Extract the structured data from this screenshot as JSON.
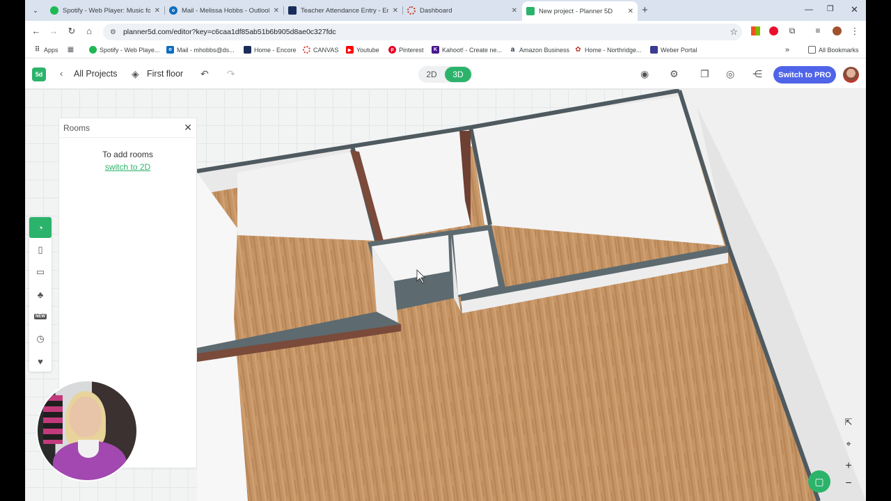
{
  "browser": {
    "tabs": [
      {
        "title": "Spotify - Web Player: Music for",
        "color": "#1db954",
        "active": false
      },
      {
        "title": "Mail - Melissa Hobbs - Outlook",
        "color": "#0f6cbd",
        "active": false
      },
      {
        "title": "Teacher Attendance Entry - Enc",
        "color": "#1a2d5a",
        "active": false
      },
      {
        "title": "Dashboard",
        "color": "#c0392b",
        "active": false
      },
      {
        "title": "New project - Planner 5D",
        "color": "#2cb36b",
        "active": true
      }
    ],
    "url": "planner5d.com/editor?key=c6caa1df85ab51b6b905d8ae0c327fdc",
    "bookmarks": [
      {
        "label": "Apps",
        "color": "#5f6368"
      },
      {
        "label": "Spotify - Web Playe...",
        "color": "#1db954"
      },
      {
        "label": "Mail - mhobbs@ds...",
        "color": "#0f6cbd"
      },
      {
        "label": "Home - Encore",
        "color": "#1a2d5a"
      },
      {
        "label": "CANVAS",
        "color": "#e03c31"
      },
      {
        "label": "Youtube",
        "color": "#ff0000"
      },
      {
        "label": "Pinterest",
        "color": "#e60023"
      },
      {
        "label": "Kahoot! - Create ne...",
        "color": "#46178f"
      },
      {
        "label": "Amazon Business",
        "color": "#232f3e"
      },
      {
        "label": "Home - Northridge...",
        "color": "#c0392b"
      },
      {
        "label": "Weber Portal",
        "color": "#3b3b8f"
      }
    ],
    "all_bookmarks": "All Bookmarks"
  },
  "app": {
    "logo": "5d",
    "back_label": "All Projects",
    "floor_label": "First floor",
    "mode_2d": "2D",
    "mode_3d": "3D",
    "pro_label": "Switch to PRO",
    "accent": "#2cb36b",
    "pro_color": "#4f64e8"
  },
  "rooms_panel": {
    "title": "Rooms",
    "message": "To add rooms",
    "link": "switch to 2D"
  },
  "left_tools": {
    "new_badge": "NEW"
  }
}
